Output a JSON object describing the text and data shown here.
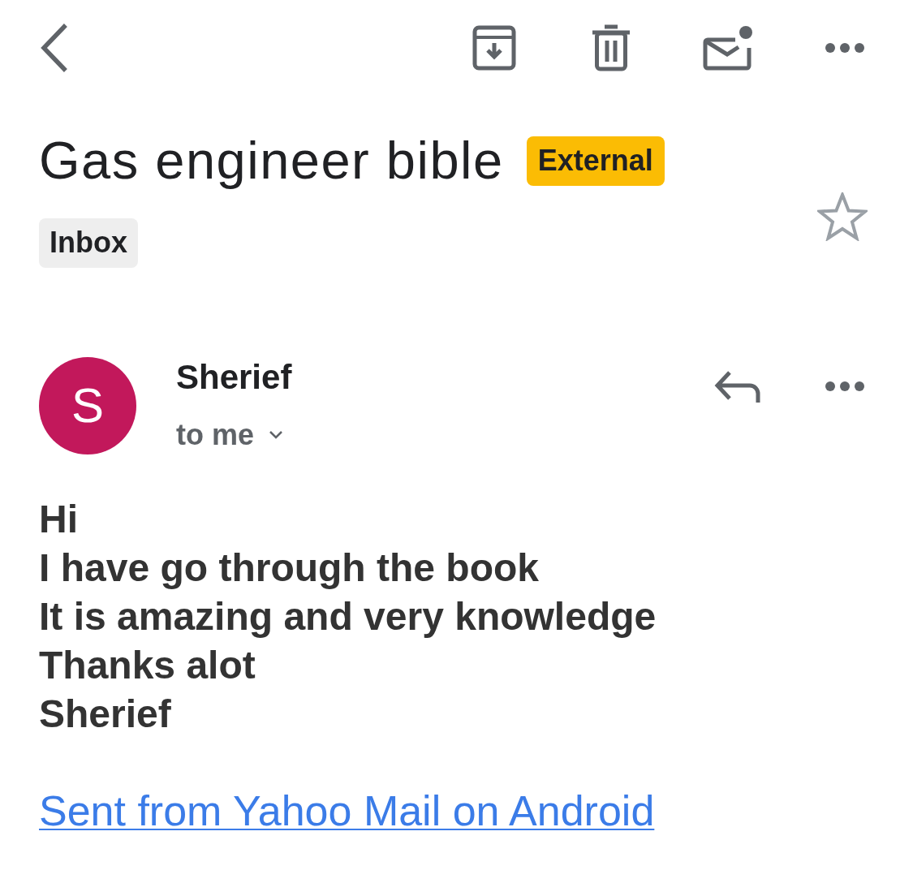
{
  "subject": {
    "title": "Gas engineer bible",
    "badge": "External",
    "labels": [
      "Inbox"
    ],
    "starred": false
  },
  "message": {
    "avatar_letter": "S",
    "sender": "Sherief",
    "recipients": "to me",
    "body": [
      "Hi",
      "I have go through the book",
      "It is amazing and very knowledge",
      "Thanks alot",
      "Sherief"
    ],
    "signature_link": "Sent from Yahoo Mail on Android"
  }
}
